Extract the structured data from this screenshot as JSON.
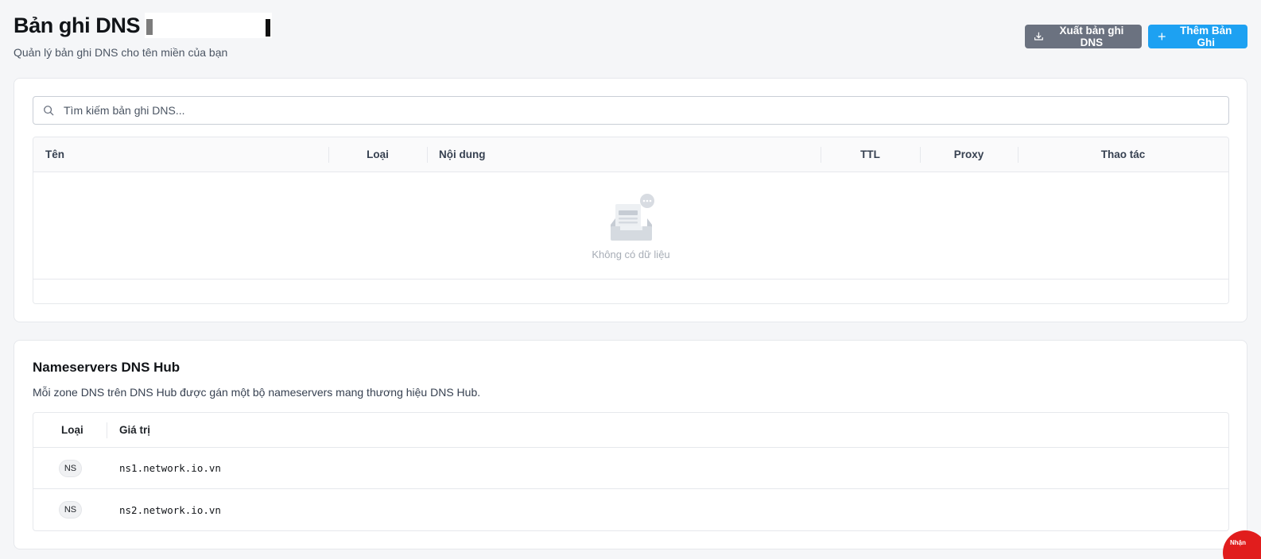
{
  "header": {
    "title": "Bản ghi DNS",
    "subtitle": "Quản lý bản ghi DNS cho tên miền của bạn",
    "export_label": "Xuất bản ghi DNS",
    "add_label": "Thêm Bản Ghi"
  },
  "records": {
    "search_placeholder": "Tìm kiếm bản ghi DNS...",
    "columns": {
      "name": "Tên",
      "type": "Loại",
      "content": "Nội dung",
      "ttl": "TTL",
      "proxy": "Proxy",
      "actions": "Thao tác"
    },
    "empty_text": "Không có dữ liệu"
  },
  "nameservers": {
    "title": "Nameservers DNS Hub",
    "description": "Mỗi zone DNS trên DNS Hub được gán một bộ nameservers mang thương hiệu DNS Hub.",
    "columns": {
      "type": "Loại",
      "value": "Giá trị"
    },
    "rows": [
      {
        "type": "NS",
        "value": "ns1.network.io.vn"
      },
      {
        "type": "NS",
        "value": "ns2.network.io.vn"
      }
    ]
  },
  "chat": {
    "label": "Nhận"
  },
  "colors": {
    "primary": "#1da1f2",
    "secondary": "#6b7280",
    "chat": "#e11d1d"
  },
  "icons": {
    "export": "download-icon",
    "add": "plus-icon",
    "search": "search-icon",
    "empty": "empty-inbox-icon"
  }
}
